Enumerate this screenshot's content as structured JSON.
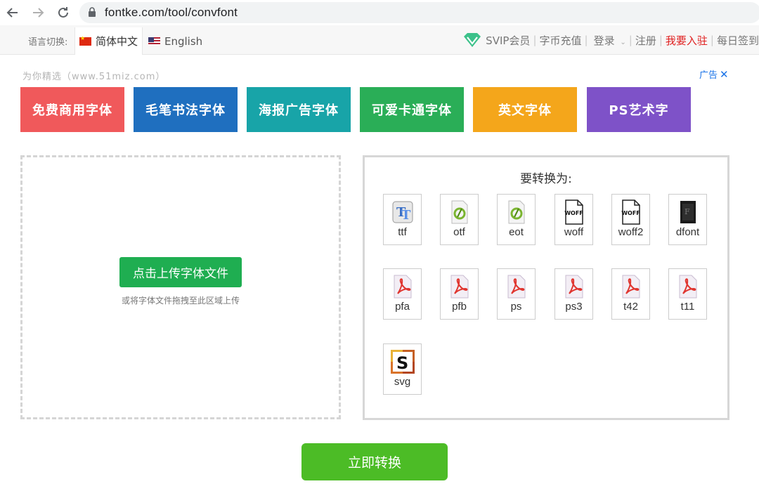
{
  "browser": {
    "url": "fontke.com/tool/convfont"
  },
  "site_bar": {
    "lang_label": "语言切换:",
    "lang_cn": "简体中文",
    "lang_en": "English",
    "svip": "SVIP会员",
    "recharge": "字币充值",
    "login": "登录",
    "register": "注册",
    "join": "我要入驻",
    "signin": "每日签到"
  },
  "ads": {
    "label": "为你精选（www.51miz.com）",
    "ad_tag": "广告",
    "tiles": [
      {
        "text": "免费商用字体",
        "color": "#f0595b"
      },
      {
        "text": "毛笔书法字体",
        "color": "#1f6fbf"
      },
      {
        "text": "海报广告字体",
        "color": "#18a4a8"
      },
      {
        "text": "可爱卡通字体",
        "color": "#2aae57"
      },
      {
        "text": "英文字体",
        "color": "#f4a61b"
      },
      {
        "text": "PS艺术字",
        "color": "#7e52c8"
      }
    ]
  },
  "upload": {
    "button": "点击上传字体文件",
    "hint": "或将字体文件拖拽至此区域上传"
  },
  "convert": {
    "title": "要转换为:",
    "formats": [
      {
        "label": "ttf",
        "icon": "ttf-icon"
      },
      {
        "label": "otf",
        "icon": "opentype-icon"
      },
      {
        "label": "eot",
        "icon": "opentype-icon"
      },
      {
        "label": "woff",
        "icon": "woff-file-icon"
      },
      {
        "label": "woff2",
        "icon": "woff-file-icon"
      },
      {
        "label": "dfont",
        "icon": "dfont-icon"
      },
      {
        "label": "pfa",
        "icon": "pdf-icon"
      },
      {
        "label": "pfb",
        "icon": "pdf-icon"
      },
      {
        "label": "ps",
        "icon": "pdf-icon"
      },
      {
        "label": "ps3",
        "icon": "pdf-icon"
      },
      {
        "label": "t42",
        "icon": "pdf-icon"
      },
      {
        "label": "t11",
        "icon": "pdf-icon"
      },
      {
        "label": "svg",
        "icon": "svg-icon"
      }
    ],
    "woff_badge": "WOFF",
    "button": "立即转换"
  }
}
